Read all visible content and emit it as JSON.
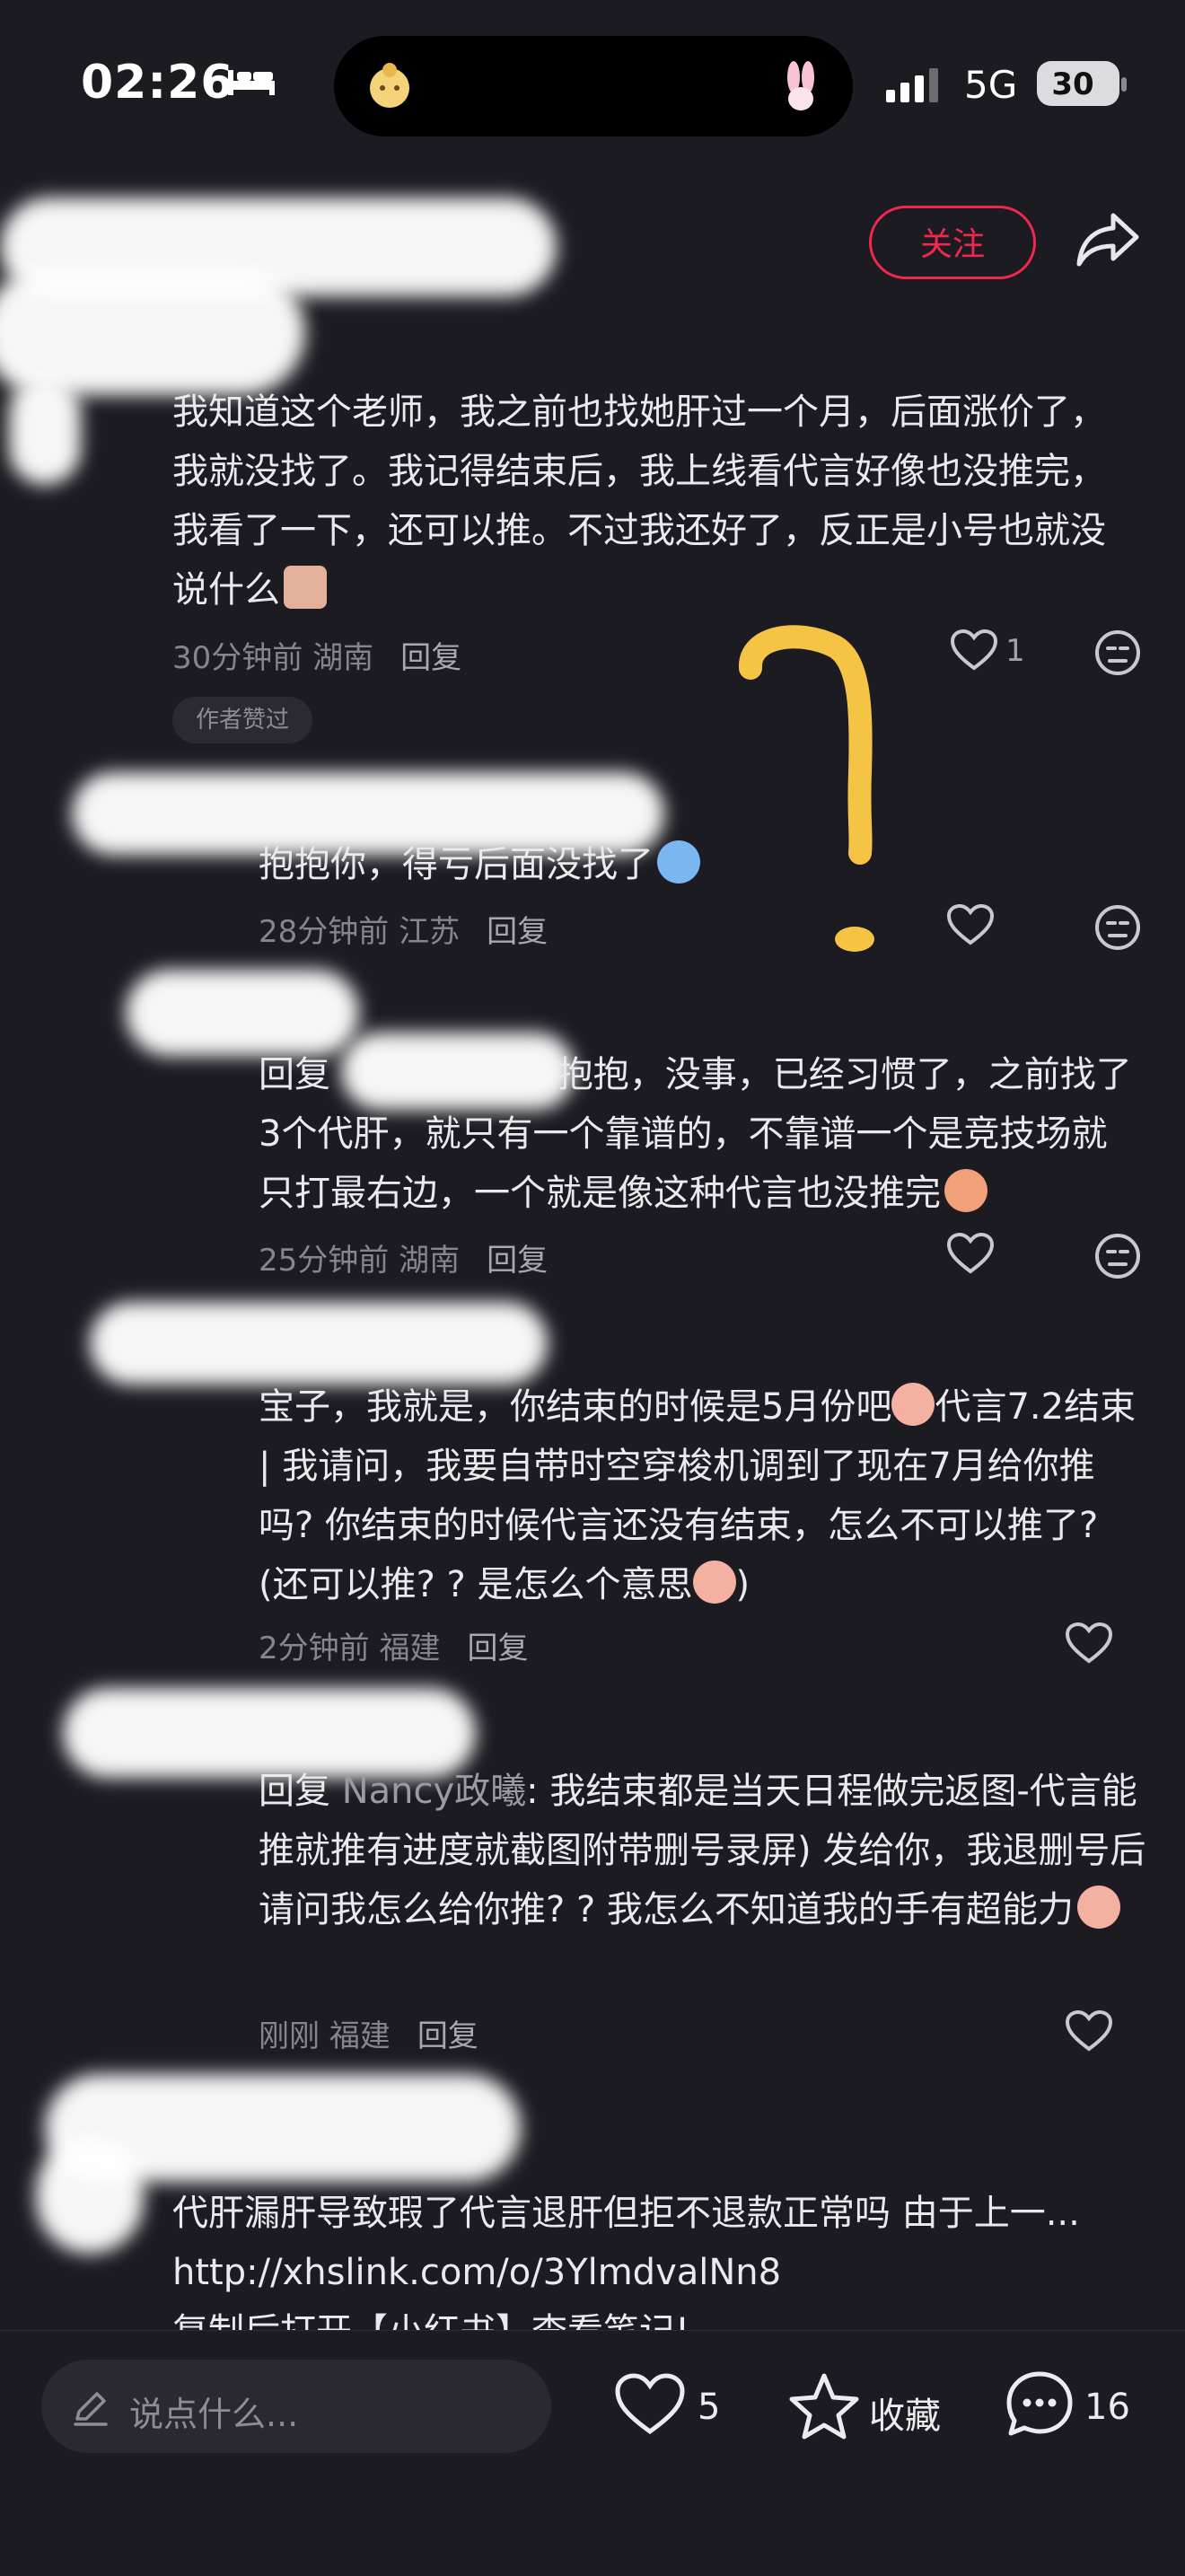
{
  "status": {
    "time": "02:26",
    "network": "5G",
    "battery": "30"
  },
  "header": {
    "follow_label": "关注"
  },
  "comments": [
    {
      "text": "我知道这个老师，我之前也找她肝过一个月，后面涨价了，我就没找了。我记得结束后，我上线看代言好像也没推完，我看了一下，还可以推。不过我还好了，反正是小号也就没说什么",
      "time": "30分钟前",
      "location": "湖南",
      "reply_label": "回复",
      "likes": "1",
      "badge": "作者赞过"
    },
    {
      "text": "抱抱你，得亏后面没找了",
      "time": "28分钟前",
      "location": "江苏",
      "reply_label": "回复"
    },
    {
      "text": "回复 ",
      "text_rest": "抱抱，没事，已经习惯了，之前找了3个代肝，就只有一个靠谱的，不靠谱一个是竞技场就只打最右边，一个就是像这种代言也没推完",
      "time": "25分钟前",
      "location": "湖南",
      "reply_label": "回复"
    },
    {
      "text": "宝子，我就是，你结束的时候是5月份吧",
      "text_rest": "代言7.2结束 | 我请问，我要自带时空穿梭机调到了现在7月给你推吗? 你结束的时候代言还没有结束，怎么不可以推了? (还可以推? ? 是怎么个意思",
      "text_end": ")",
      "time": "2分钟前",
      "location": "福建",
      "reply_label": "回复"
    },
    {
      "reply_prefix": "回复 ",
      "reply_to": "Nancy政曦",
      "text": ": 我结束都是当天日程做完返图-代言能推就推有进度就截图附带删号录屏) 发给你，我退删号后请问我怎么给你推? ? 我怎么不知道我的手有超能力",
      "time": "刚刚",
      "location": "福建",
      "reply_label": "回复"
    },
    {
      "text": "代肝漏肝导致瑕了代言退肝但拒不退款正常吗 由于上一...",
      "link": "http://xhslink.com/o/3YlmdvalNn8",
      "tail": "复制后打开【小红书】查看笔记!"
    }
  ],
  "bottom": {
    "input_placeholder": "说点什么...",
    "likes": "5",
    "collect_label": "收藏",
    "comments": "16"
  },
  "colors": {
    "accent": "#f0284e",
    "background": "#1c1b22",
    "annotation": "#f6c445"
  }
}
